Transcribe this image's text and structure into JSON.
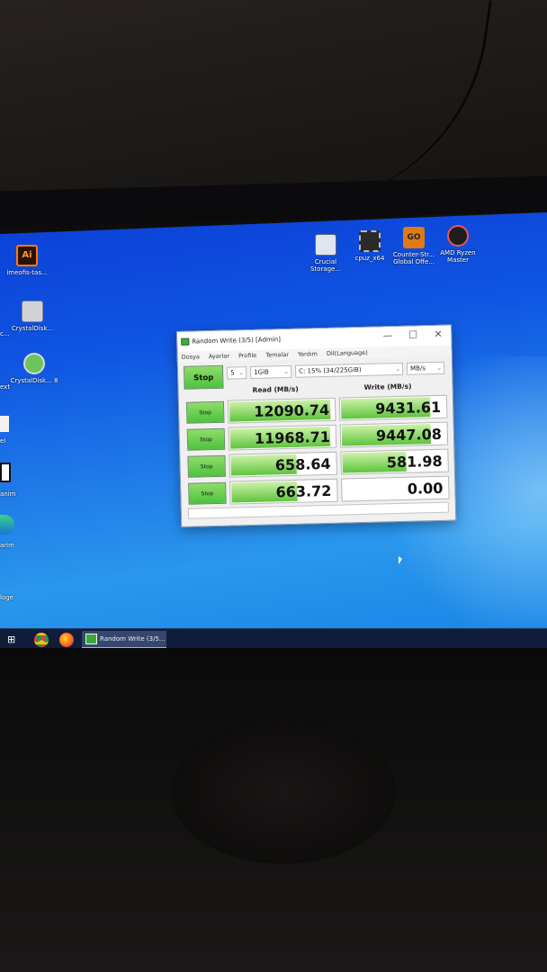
{
  "desktop": {
    "top_icons": [
      {
        "name": "crucial-storage-icon",
        "label": "Crucial Storage...",
        "color": "#dfe6ee"
      },
      {
        "name": "cpuz-icon",
        "label": "cpuz_x64",
        "color": "#2a2a2a"
      },
      {
        "name": "counter-strike-icon",
        "label": "Counter-Str... Global Offe...",
        "color": "#e07a12"
      },
      {
        "name": "amd-ryzen-master-icon",
        "label": "AMD Ryzen Master",
        "color": "#1e1e1e"
      }
    ],
    "left_labels": [
      {
        "name": "illustrator-icon",
        "label": "imeofis-tas...",
        "color": "#ff7c00"
      },
      {
        "name": "crystaldisk-icon-1",
        "label": "CrystalDisk...",
        "color": "#cfd3d8"
      },
      {
        "name": "crystaldisk-icon-2",
        "label": "CrystalDisk... 8",
        "color": "#6ec45c"
      },
      {
        "name": "partial-icon-a",
        "label": "c...",
        "color": "#5fae5f"
      },
      {
        "name": "partial-icon-b",
        "label": "ext",
        "color": "#3e87e0"
      },
      {
        "name": "partial-icon-c",
        "label": "el",
        "color": "#f2f2f2"
      },
      {
        "name": "partial-icon-d",
        "label": "anim",
        "color": "#111111"
      },
      {
        "name": "edge-icon",
        "label": "arim",
        "color": "#2ba36a"
      },
      {
        "name": "partial-icon-e",
        "label": "loge",
        "color": "#1a6ad0"
      }
    ]
  },
  "taskbar": {
    "task_view": "⊞",
    "active_app": "Random Write (3/5..."
  },
  "window": {
    "title": "Random Write (3/5) [Admin]",
    "controls": {
      "minimize": "—",
      "maximize": "☐",
      "close": "✕"
    },
    "menu": [
      "Dosya",
      "Ayarlar",
      "Profile",
      "Temalar",
      "Yardım",
      "Dil(Language)"
    ],
    "start_button": "Stop",
    "count_select": "5",
    "size_select": "1GiB",
    "drive_select": "C: 15% (34/225GiB)",
    "unit_select": "MB/s",
    "read_header": "Read (MB/s)",
    "write_header": "Write (MB/s)",
    "rows": [
      {
        "button": "Stop",
        "read": "12090.74",
        "write": "9431.61",
        "read_fill": 0.95,
        "write_fill": 0.84
      },
      {
        "button": "Stop",
        "read": "11968.71",
        "write": "9447.08",
        "read_fill": 0.94,
        "write_fill": 0.84
      },
      {
        "button": "Stop",
        "read": "658.64",
        "write": "581.98",
        "read_fill": 0.62,
        "write_fill": 0.6
      },
      {
        "button": "Stop",
        "read": "663.72",
        "write": "0.00",
        "read_fill": 0.62,
        "write_fill": 0.0
      }
    ]
  }
}
